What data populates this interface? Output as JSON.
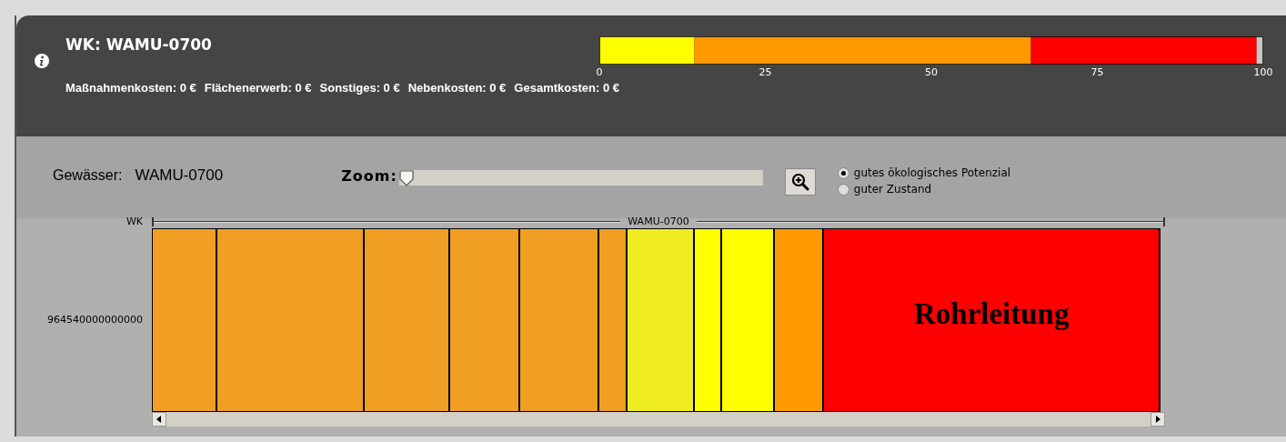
{
  "header": {
    "title": "WK: WAMU-0700",
    "costs": [
      {
        "label": "Maßnahmenkosten:",
        "value": "0 €"
      },
      {
        "label": "Flächenerwerb:",
        "value": "0 €"
      },
      {
        "label": "Sonstiges:",
        "value": "0 €"
      },
      {
        "label": "Nebenkosten:",
        "value": "0 €"
      },
      {
        "label": "Gesamtkosten:",
        "value": "0 €"
      }
    ],
    "chart_data": {
      "type": "bar",
      "orientation": "horizontal",
      "stacked": true,
      "xlim": [
        0,
        100
      ],
      "xticks": [
        0,
        25,
        50,
        75,
        100
      ],
      "series": [
        {
          "color": "#ffff00",
          "values": [
            14.3
          ]
        },
        {
          "color": "#ff9900",
          "values": [
            50.7
          ]
        },
        {
          "color": "#ff0000",
          "values": [
            34
          ]
        },
        {
          "color": "#c8c8c8",
          "values": [
            1
          ]
        }
      ]
    }
  },
  "controls": {
    "water_label": "Gewässer:",
    "water_value": "WAMU-0700",
    "zoom_label": "Zoom:",
    "zoom": {
      "level": 0
    },
    "options": [
      {
        "label": "gutes ökologisches Potenzial",
        "selected": true
      },
      {
        "label": "guter Zustand",
        "selected": false
      }
    ]
  },
  "track": {
    "row_label": "WK",
    "wk_label": "WAMU-0700",
    "segment_row_label": "964540000000000",
    "segments": [
      {
        "color": "#f09e24"
      },
      {
        "color": "#f09e24"
      },
      {
        "color": "#f09e24"
      },
      {
        "color": "#f09e24"
      },
      {
        "color": "#f09e24"
      },
      {
        "color": "#f09e24"
      },
      {
        "color": "#f0ec24"
      },
      {
        "color": "#ffff00"
      },
      {
        "color": "#ffff00"
      },
      {
        "color": "#ff9900"
      },
      {
        "color": "#ff0000",
        "label": "Rohrleitung"
      }
    ]
  }
}
